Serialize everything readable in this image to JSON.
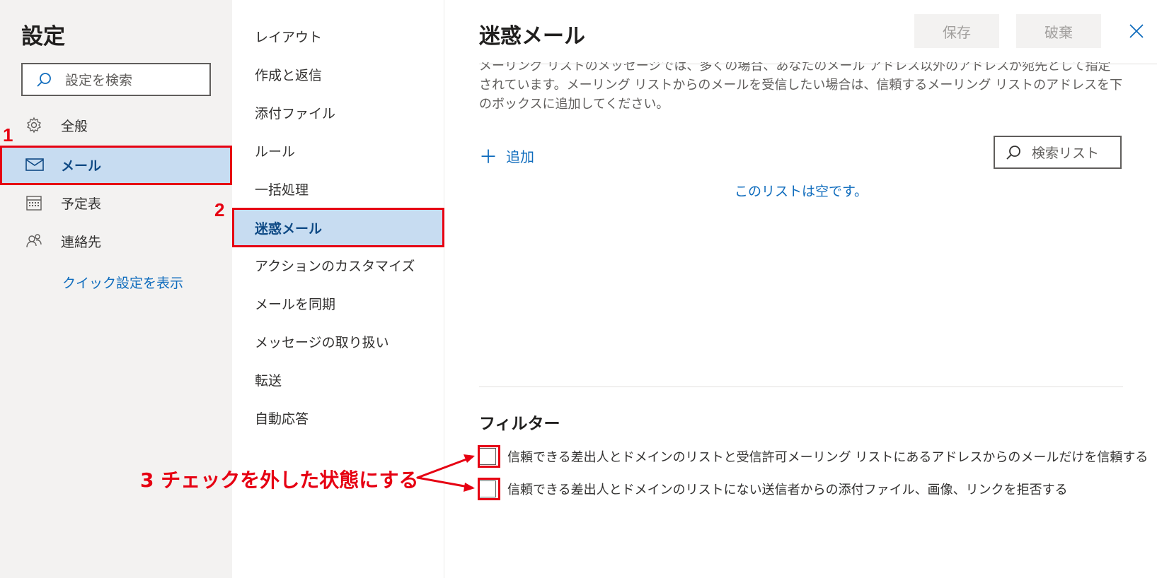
{
  "left": {
    "title": "設定",
    "search_placeholder": "設定を検索",
    "categories": [
      {
        "label": "全般",
        "icon": "gear-icon"
      },
      {
        "label": "メール",
        "icon": "mail-icon"
      },
      {
        "label": "予定表",
        "icon": "calendar-icon"
      },
      {
        "label": "連絡先",
        "icon": "people-icon"
      }
    ],
    "quick_link": "クイック設定を表示"
  },
  "middle": {
    "items": [
      "レイアウト",
      "作成と返信",
      "添付ファイル",
      "ルール",
      "一括処理",
      "迷惑メール",
      "アクションのカスタマイズ",
      "メールを同期",
      "メッセージの取り扱い",
      "転送",
      "自動応答"
    ],
    "selected": "迷惑メール"
  },
  "right": {
    "title": "迷惑メール",
    "save_label": "保存",
    "discard_label": "破棄",
    "description": "メーリング リストのメッセージでは、多くの場合、あなたのメール アドレス以外のアドレスが宛先として指定されています。メーリング リストからのメールを受信したい場合は、信頼するメーリング リストのアドレスを下のボックスに追加してください。",
    "add_label": "追加",
    "list_search_placeholder": "検索リスト",
    "empty_text": "このリストは空です。",
    "filter_title": "フィルター",
    "filters": [
      {
        "label": "信頼できる差出人とドメインのリストと受信許可メーリング リストにあるアドレスからのメールだけを信頼する",
        "checked": false
      },
      {
        "label": "信頼できる差出人とドメインのリストにない送信者からの添付ファイル、画像、リンクを拒否する",
        "checked": false
      }
    ]
  },
  "annotations": {
    "step1": "1",
    "step2": "2",
    "step3": "3 チェックを外した状態にする",
    "color": "#e60012"
  },
  "colors": {
    "accent": "#0f6cbd",
    "selected_bg": "#c7dcf1",
    "pane_bg": "#f3f2f1"
  }
}
